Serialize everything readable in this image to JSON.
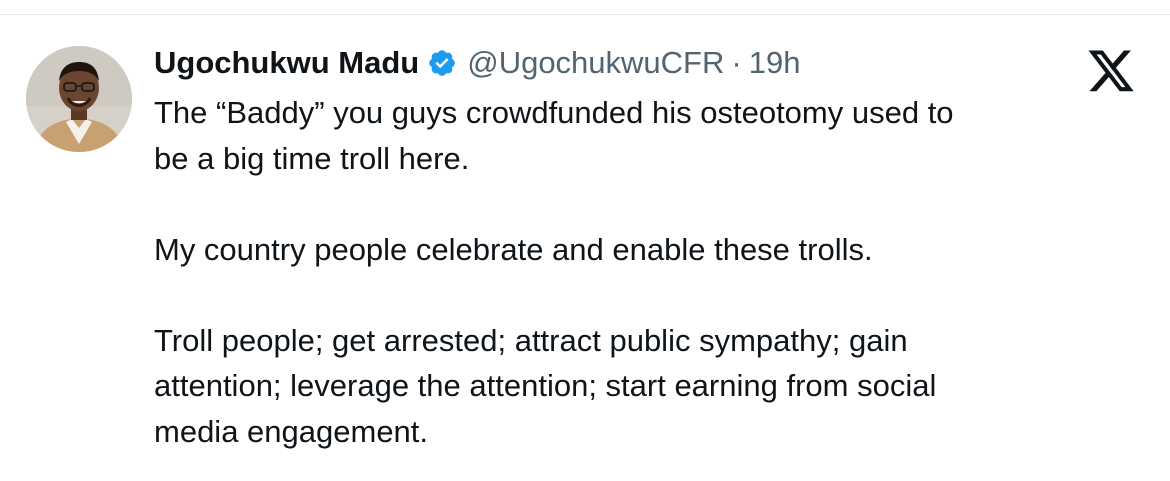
{
  "tweet": {
    "author": {
      "display_name": "Ugochukwu Madu",
      "handle": "@UgochukwuCFR",
      "verified": true,
      "avatar_icon": "profile-photo"
    },
    "separator": "·",
    "time": "19h",
    "paragraphs": [
      "The “Baddy” you guys crowdfunded his osteotomy used to\nbe a big time troll here.",
      "My country people celebrate and enable these trolls.",
      "Troll people; get arrested; attract public sympathy; gain\nattention; leverage the attention; start earning from social\nmedia engagement."
    ]
  },
  "colors": {
    "text_primary": "#0f1419",
    "text_secondary": "#536471",
    "verified_blue": "#1d9bf0",
    "divider": "#e6e8ea"
  },
  "icons": {
    "verified": "verified-badge-icon",
    "brand": "x-logo-icon"
  }
}
